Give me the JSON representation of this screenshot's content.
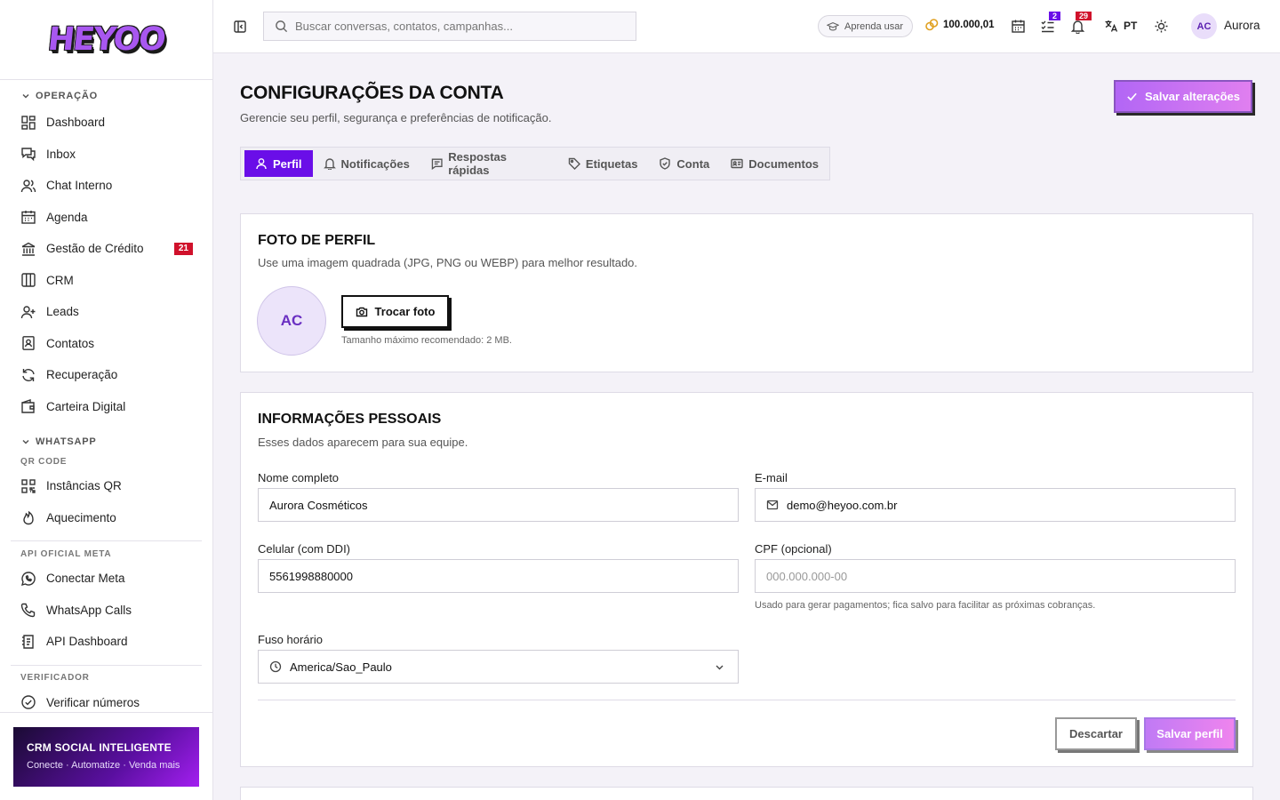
{
  "brand": {
    "logo_text": "HEYOO",
    "accent": "#6a0ee8"
  },
  "sidebar": {
    "sections": [
      {
        "label": "OPERAÇÃO"
      },
      {
        "label": "WHATSAPP"
      }
    ],
    "sub_headers": [
      "QR CODE",
      "API OFICIAL META",
      "VERIFICADOR"
    ],
    "items": [
      {
        "label": "Dashboard",
        "icon": "dashboard-icon"
      },
      {
        "label": "Inbox",
        "icon": "inbox-icon"
      },
      {
        "label": "Chat Interno",
        "icon": "users-icon"
      },
      {
        "label": "Agenda",
        "icon": "calendar-icon"
      },
      {
        "label": "Gestão de Crédito",
        "icon": "bank-icon",
        "badge": "21"
      },
      {
        "label": "CRM",
        "icon": "kanban-icon"
      },
      {
        "label": "Leads",
        "icon": "user-plus-icon"
      },
      {
        "label": "Contatos",
        "icon": "contact-book-icon"
      },
      {
        "label": "Recuperação",
        "icon": "refresh-icon"
      },
      {
        "label": "Carteira Digital",
        "icon": "wallet-icon"
      },
      {
        "label": "Instâncias QR",
        "icon": "qr-code-icon"
      },
      {
        "label": "Aquecimento",
        "icon": "flame-icon"
      },
      {
        "label": "Conectar Meta",
        "icon": "whatsapp-icon"
      },
      {
        "label": "WhatsApp Calls",
        "icon": "phone-icon"
      },
      {
        "label": "API Dashboard",
        "icon": "api-document-icon"
      },
      {
        "label": "Verificar números",
        "icon": "check-circle-icon"
      }
    ],
    "promo": {
      "title": "CRM SOCIAL INTELIGENTE",
      "subtitle": "Conecte · Automatize · Venda mais"
    }
  },
  "topbar": {
    "search_placeholder": "Buscar conversas, contatos, campanhas...",
    "learn_label": "Aprenda usar",
    "coins": "100.000,01",
    "tasks_badge": "2",
    "notifications_badge": "29",
    "language": "PT",
    "user_initials": "AC",
    "user_name": "Aurora"
  },
  "page": {
    "title": "CONFIGURAÇÕES DA CONTA",
    "subtitle": "Gerencie seu perfil, segurança e preferências de notificação.",
    "save_all_label": "Salvar alterações",
    "tabs": [
      {
        "label": "Perfil",
        "icon": "user-icon"
      },
      {
        "label": "Notificações",
        "icon": "bell-icon"
      },
      {
        "label": "Respostas rápidas",
        "icon": "message-icon"
      },
      {
        "label": "Etiquetas",
        "icon": "tag-icon"
      },
      {
        "label": "Conta",
        "icon": "shield-check-icon"
      },
      {
        "label": "Documentos",
        "icon": "id-card-icon"
      }
    ]
  },
  "photo_card": {
    "title": "FOTO DE PERFIL",
    "subtitle": "Use uma imagem quadrada (JPG, PNG ou WEBP) para melhor resultado.",
    "initials": "AC",
    "change_label": "Trocar foto",
    "hint": "Tamanho máximo recomendado: 2 MB."
  },
  "personal_card": {
    "title": "INFORMAÇÕES PESSOAIS",
    "subtitle": "Esses dados aparecem para sua equipe.",
    "name_label": "Nome completo",
    "name_value": "Aurora Cosméticos",
    "email_label": "E-mail",
    "email_value": "demo@heyoo.com.br",
    "phone_label": "Celular (com DDI)",
    "phone_value": "5561998880000",
    "cpf_label": "CPF (opcional)",
    "cpf_placeholder": "000.000.000-00",
    "cpf_hint": "Usado para gerar pagamentos; fica salvo para facilitar as próximas cobranças.",
    "tz_label": "Fuso horário",
    "tz_value": "America/Sao_Paulo",
    "discard_label": "Descartar",
    "save_label": "Salvar perfil"
  }
}
